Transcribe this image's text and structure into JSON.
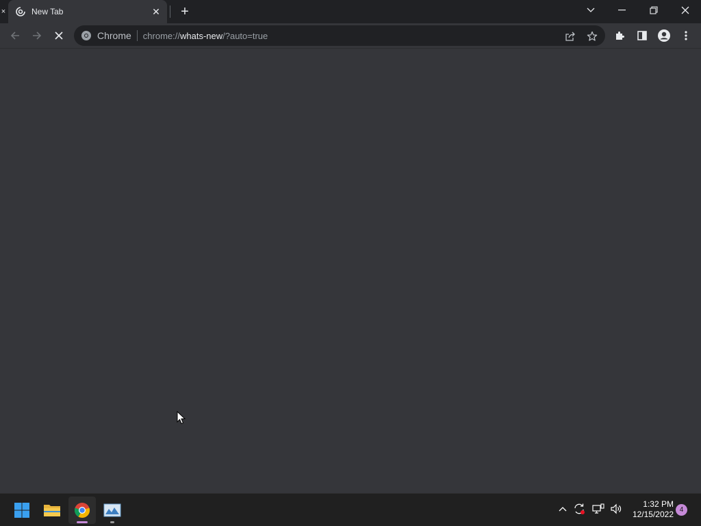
{
  "browser": {
    "tab": {
      "title": "New Tab"
    },
    "omnibox": {
      "chip_label": "Chrome",
      "url_prefix": "chrome://",
      "url_host": "whats-new",
      "url_suffix": "/?auto=true"
    },
    "icons": {
      "favicon": "loading-favicon-icon",
      "back": "arrow-left-icon",
      "forward": "arrow-right-icon",
      "stop": "close-icon",
      "site_info": "chrome-logo-icon",
      "share": "share-icon",
      "bookmark": "star-icon",
      "extensions": "puzzle-icon",
      "side_panel": "side-panel-icon",
      "profile": "person-icon",
      "menu": "more-vertical-icon"
    },
    "colors": {
      "frame": "#202124",
      "toolbar": "#35363a",
      "content": "#35363a"
    }
  },
  "taskbar": {
    "apps": [
      "start",
      "file-explorer",
      "chrome",
      "image-viewer"
    ],
    "clock": {
      "time": "1:32 PM",
      "date": "12/15/2022"
    },
    "notification_count": "4",
    "colors": {
      "background": "#202020",
      "accent": "#c68ad8"
    }
  }
}
